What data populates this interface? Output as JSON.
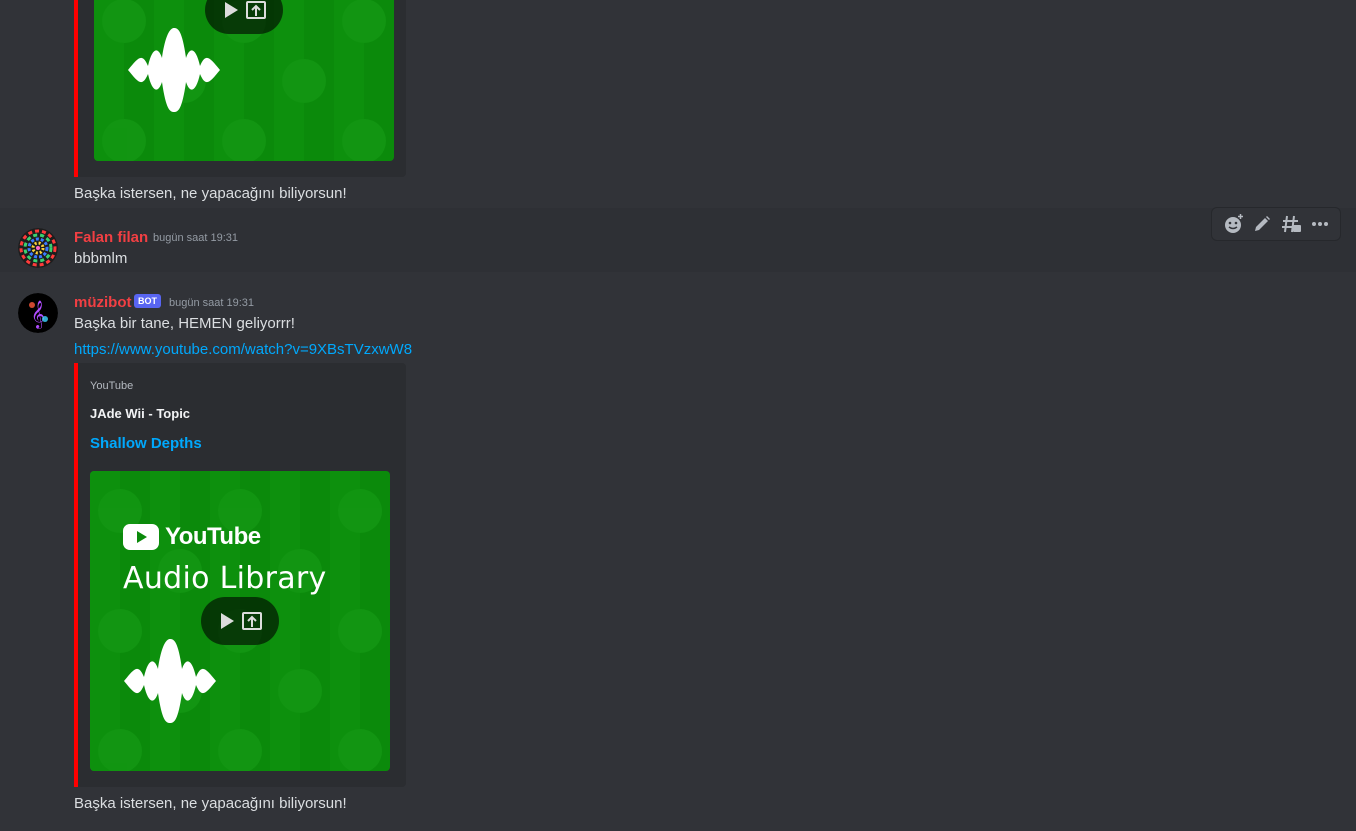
{
  "colors": {
    "background": "#313338",
    "embed_bg": "#2b2d31",
    "embed_border": "#ff0000",
    "username_red": "#f23f43",
    "link": "#00a8fc",
    "bot_tag": "#5865f2",
    "thumbnail_green": "#0b8a0b"
  },
  "top_embed": {
    "thumbnail_icon": "youtube-audio-library-thumbnail"
  },
  "top_followup": "Başka istersen, ne yapacağını biliyorsun!",
  "message_1": {
    "username": "Falan filan",
    "timestamp": "bugün saat 19:31",
    "content": "bbbmlm"
  },
  "message_2": {
    "username": "müzibot",
    "bot_tag": "BOT",
    "timestamp": "bugün saat 19:31",
    "content": "Başka bir tane, HEMEN geliyorrr!",
    "link": "https://www.youtube.com/watch?v=9XBsTVzxwW8",
    "embed": {
      "provider": "YouTube",
      "author": "JAde Wii - Topic",
      "title": "Shallow Depths",
      "thumb_logo": "YouTube",
      "thumb_text": "Audio Library"
    },
    "followup": "Başka istersen, ne yapacağını biliyorsun!"
  },
  "toolbar": {
    "icons": [
      "add-reaction-icon",
      "edit-icon",
      "create-thread-icon",
      "more-icon"
    ]
  }
}
